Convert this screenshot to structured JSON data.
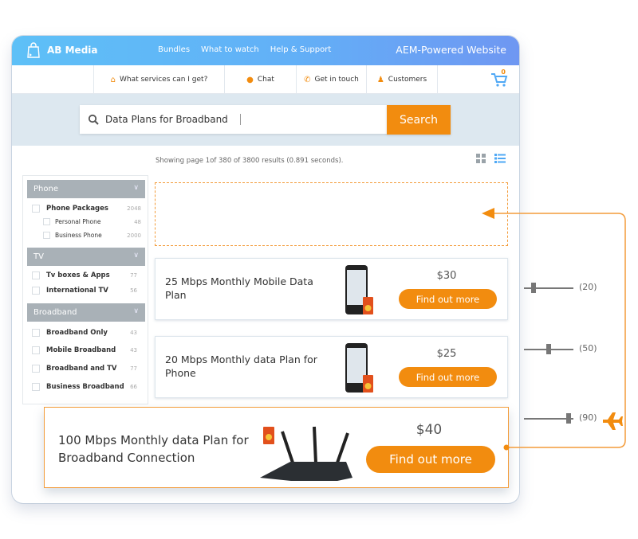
{
  "header": {
    "brand": "AB Media",
    "nav": [
      "Bundles",
      "What to watch",
      "Help & Support"
    ],
    "site_title": "AEM-Powered Website",
    "accent": "#f28c0f",
    "bar_gradient": [
      "#5ec0f7",
      "#6f97f2"
    ]
  },
  "subnav": {
    "items": [
      {
        "label": "What services can I get?",
        "icon": "home-icon"
      },
      {
        "label": "Chat",
        "icon": "chat-bubble-icon"
      },
      {
        "label": "Get in touch",
        "icon": "phone-icon"
      },
      {
        "label": "Customers",
        "icon": "user-icon"
      }
    ],
    "cart_count": "0"
  },
  "search": {
    "value": "Data Plans for Broadband",
    "button_label": "Search"
  },
  "results": {
    "info": "Showing page 1of 380 of 3800 results (0.891 seconds).",
    "view_modes": [
      "grid",
      "list"
    ],
    "active_view": "list"
  },
  "sidebar": {
    "categories": [
      {
        "name": "Phone",
        "options": [
          {
            "label": "Phone Packages",
            "count": "2048"
          },
          {
            "label": "Personal Phone",
            "count": "48"
          },
          {
            "label": "Business Phone",
            "count": "2000"
          }
        ]
      },
      {
        "name": "TV",
        "options": [
          {
            "label": "Tv boxes & Apps",
            "count": "77"
          },
          {
            "label": "International TV",
            "count": "56"
          }
        ]
      },
      {
        "name": "Broadband",
        "options": [
          {
            "label": "Broadband Only",
            "count": "43"
          },
          {
            "label": "Mobile Broadband",
            "count": "43"
          },
          {
            "label": "Broadband and TV",
            "count": "77"
          },
          {
            "label": "Business Broadband",
            "count": "66"
          }
        ]
      }
    ]
  },
  "plans": [
    {
      "title": "25 Mbps Monthly Mobile Data Plan",
      "price": "$30",
      "button": "Find out more",
      "image": "phone-with-sim"
    },
    {
      "title": "20 Mbps Monthly data Plan for Phone",
      "price": "$25",
      "button": "Find out more",
      "image": "phone-with-sim"
    },
    {
      "title": "100 Mbps Monthly data Plan for Broadband Connection",
      "price": "$40",
      "button": "Find out more",
      "image": "router-with-sim"
    }
  ],
  "sliders": [
    {
      "value": 20,
      "label": "(20)"
    },
    {
      "value": 50,
      "label": "(50)"
    },
    {
      "value": 90,
      "label": "(90)"
    }
  ]
}
